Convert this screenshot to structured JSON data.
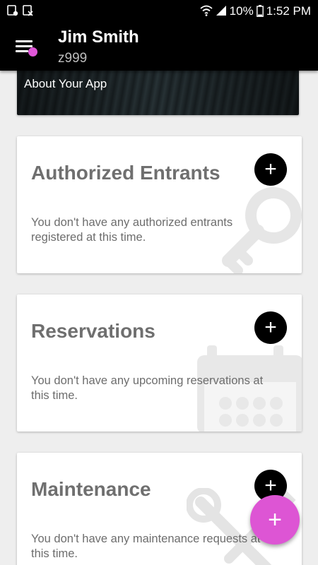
{
  "status_bar": {
    "battery": "10%",
    "time": "1:52 PM"
  },
  "header": {
    "user_name": "Jim Smith",
    "user_id": "z999"
  },
  "about": {
    "label": "About Your App"
  },
  "cards": [
    {
      "title": "Authorized Entrants",
      "text": "You don't have any authorized entrants registered at this time.",
      "icon": "key-icon"
    },
    {
      "title": "Reservations",
      "text": "You don't have any upcoming reservations at this time.",
      "icon": "calendar-icon"
    },
    {
      "title": "Maintenance",
      "text": "You don't have any maintenance requests at this time.",
      "icon": "tools-icon"
    }
  ],
  "colors": {
    "accent": "#dd55d4",
    "header_bg": "#000000",
    "background": "#eeeeee"
  }
}
